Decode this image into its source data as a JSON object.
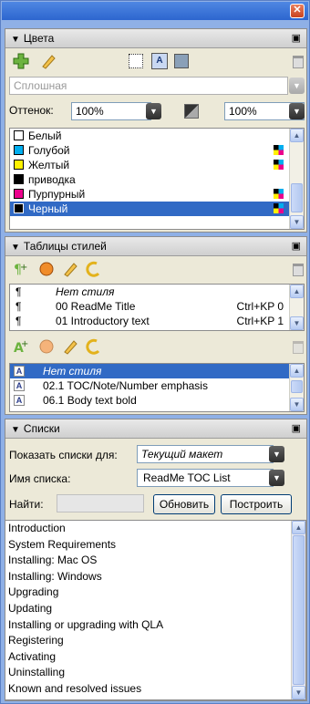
{
  "window": {
    "close_glyph": "✕"
  },
  "colors_panel": {
    "title": "Цвета",
    "type_field": "Сплошная",
    "tint_label": "Оттенок:",
    "tint_value": "100%",
    "tint_value2": "100%",
    "swatches": [
      {
        "name": "Белый",
        "color": "#ffffff",
        "cmyk": false
      },
      {
        "name": "Голубой",
        "color": "#00aeef",
        "cmyk": true
      },
      {
        "name": "Желтый",
        "color": "#fff200",
        "cmyk": true
      },
      {
        "name": "приводка",
        "color": "#000000",
        "cmyk": false
      },
      {
        "name": "Пурпурный",
        "color": "#ec008c",
        "cmyk": true
      },
      {
        "name": "Черный",
        "color": "#000000",
        "cmyk": true
      }
    ],
    "selected_index": 5
  },
  "paragraph_styles_panel": {
    "title": "Таблицы стилей",
    "styles": [
      {
        "name": "Нет стиля",
        "shortcut": "",
        "italic": true
      },
      {
        "name": "00 ReadMe Title",
        "shortcut": "Ctrl+KP 0",
        "italic": false
      },
      {
        "name": "01 Introductory text",
        "shortcut": "Ctrl+KP 1",
        "italic": false
      }
    ],
    "para_glyph": "¶"
  },
  "char_styles_panel": {
    "styles": [
      {
        "name": "Нет стиля",
        "italic": true
      },
      {
        "name": "02.1 TOC/Note/Number emphasis",
        "italic": false
      },
      {
        "name": "06.1 Body text bold",
        "italic": false
      }
    ],
    "char_glyph": "A",
    "selected_index": 0
  },
  "lists_panel": {
    "title": "Списки",
    "show_lists_for_label": "Показать списки для:",
    "show_lists_for_value": "Текущий макет",
    "list_name_label": "Имя списка:",
    "list_name_value": "ReadMe TOC List",
    "find_label": "Найти:",
    "find_value": "",
    "update_button": "Обновить",
    "build_button": "Построить",
    "items": [
      "Introduction",
      "System Requirements",
      "Installing: Mac OS",
      "Installing: Windows",
      "Upgrading",
      "Updating",
      "Installing or upgrading with QLA",
      "Registering",
      "Activating",
      "Uninstalling",
      "Known and resolved issues"
    ]
  }
}
